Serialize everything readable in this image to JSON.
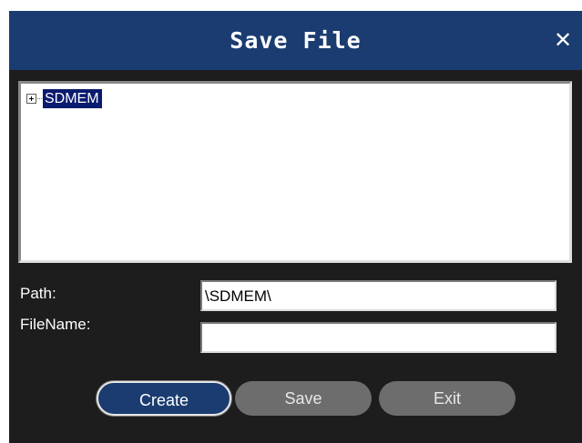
{
  "dialog": {
    "title": "Save File",
    "close_glyph": "✕",
    "close_icon": "close-icon"
  },
  "tree": {
    "nodes": [
      {
        "label": "SDMEM",
        "expander_icon": "plus-expander-icon",
        "selected": true
      }
    ]
  },
  "form": {
    "path_label": "Path:",
    "path_value": "\\SDMEM\\",
    "filename_label": "FileName:",
    "filename_value": ""
  },
  "buttons": {
    "create": "Create",
    "save": "Save",
    "exit": "Exit"
  },
  "colors": {
    "titlebar": "#1b3c70",
    "background": "#1d1d1d",
    "selection": "#0a1a6e",
    "disabled_button": "#6d6d6d"
  }
}
